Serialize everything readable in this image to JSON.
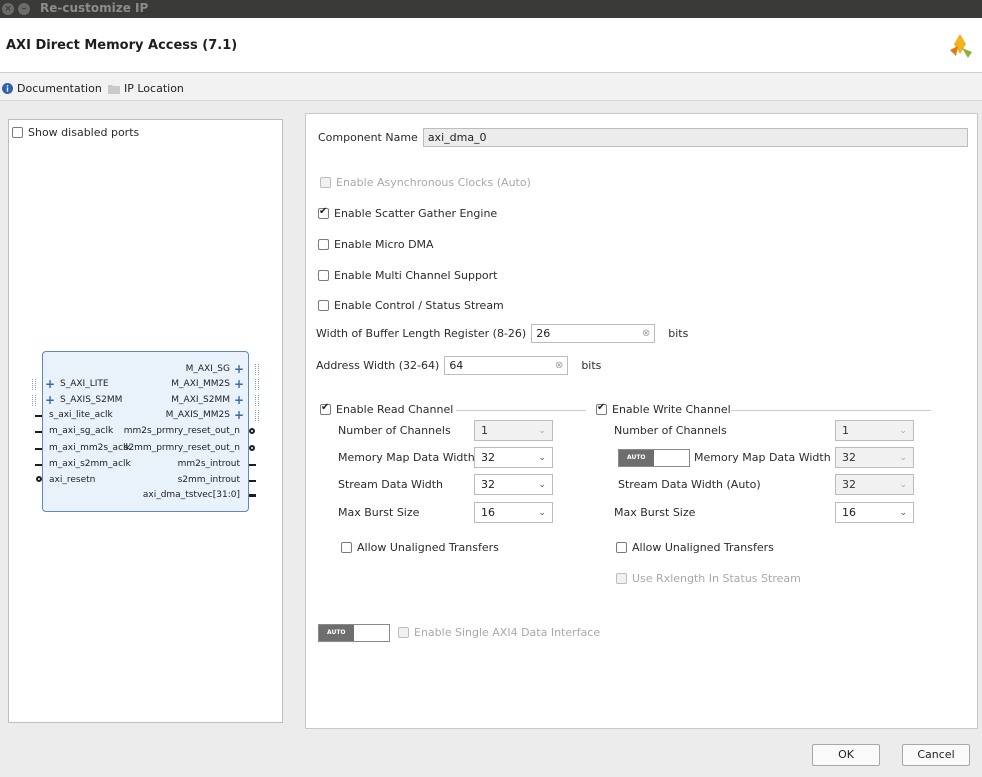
{
  "window": {
    "title": "Re-customize IP"
  },
  "header": {
    "ip_title": "AXI Direct Memory Access (7.1)",
    "logo_icon": "xilinx-logo-icon"
  },
  "docbar": {
    "documentation": "Documentation",
    "ip_location": "IP Location"
  },
  "left": {
    "show_disabled_ports": "Show disabled ports",
    "block": {
      "left_ports": [
        "S_AXI_LITE",
        "S_AXIS_S2MM",
        "s_axi_lite_aclk",
        "m_axi_sg_aclk",
        "m_axi_mm2s_aclk",
        "m_axi_s2mm_aclk",
        "axi_resetn"
      ],
      "right_ports": [
        "M_AXI_SG",
        "M_AXI_MM2S",
        "M_AXI_S2MM",
        "M_AXIS_MM2S",
        "mm2s_prmry_reset_out_n",
        "s2mm_prmry_reset_out_n",
        "mm2s_introut",
        "s2mm_introut",
        "axi_dma_tstvec[31:0]"
      ]
    }
  },
  "config": {
    "component_name_label": "Component Name",
    "component_name_value": "axi_dma_0",
    "async_clocks": "Enable Asynchronous Clocks (Auto)",
    "scatter_gather": "Enable Scatter Gather Engine",
    "micro_dma": "Enable Micro DMA",
    "multi_channel": "Enable Multi Channel Support",
    "control_status": "Enable Control / Status Stream",
    "buffer_length_label": "Width of Buffer Length Register (8-26)",
    "buffer_length_value": "26",
    "address_width_label": "Address Width (32-64)",
    "address_width_value": "64",
    "bits": "bits"
  },
  "read_channel": {
    "title": "Enable Read Channel",
    "num_channels_label": "Number of Channels",
    "num_channels_value": "1",
    "mm_data_width_label": "Memory Map Data Width",
    "mm_data_width_value": "32",
    "stream_width_label": "Stream Data Width",
    "stream_width_value": "32",
    "burst_label": "Max Burst Size",
    "burst_value": "16",
    "unaligned": "Allow Unaligned Transfers"
  },
  "write_channel": {
    "title": "Enable Write Channel",
    "num_channels_label": "Number of Channels",
    "num_channels_value": "1",
    "mm_data_width_label": "Memory Map Data Width",
    "mm_data_width_value": "32",
    "stream_width_label": "Stream Data Width (Auto)",
    "stream_width_value": "32",
    "burst_label": "Max Burst Size",
    "burst_value": "16",
    "unaligned": "Allow Unaligned Transfers",
    "rxlength": "Use Rxlength In Status Stream"
  },
  "single_axi4": "Enable Single AXI4 Data Interface",
  "auto_label": "AUTO",
  "footer": {
    "ok": "OK",
    "cancel": "Cancel"
  }
}
